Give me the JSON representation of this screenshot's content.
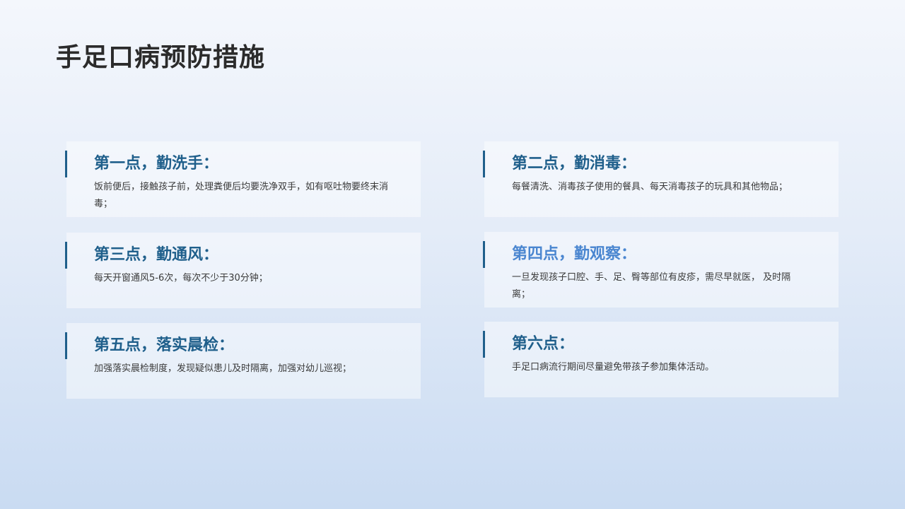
{
  "title": "手足口病预防措施",
  "colors": {
    "heading": "#1f5f8b",
    "heading_highlight": "#4a86d0",
    "accent_bar": "#1f5f8b",
    "title": "#2b2b2b",
    "body_text": "#3a3a3a"
  },
  "cards": [
    {
      "heading": "第一点，勤洗手：",
      "text": "饭前便后，接触孩子前，处理粪便后均要洗净双手，如有呕吐物要终末消毒；"
    },
    {
      "heading": "第二点，勤消毒：",
      "text": "每餐清洗、消毒孩子使用的餐具、每天消毒孩子的玩具和其他物品；"
    },
    {
      "heading": "第三点，勤通风：",
      "text": "每天开窗通风5-6次，每次不少于30分钟；"
    },
    {
      "heading": "第四点，勤观察：",
      "text": "一旦发现孩子口腔、手、足、臀等部位有皮疹，需尽早就医， 及时隔离；"
    },
    {
      "heading": "第五点，落实晨检：",
      "text": "加强落实晨检制度，发现疑似患儿及时隔离，加强对幼儿巡视；"
    },
    {
      "heading": "第六点：",
      "text": "手足口病流行期间尽量避免带孩子参加集体活动。"
    }
  ]
}
